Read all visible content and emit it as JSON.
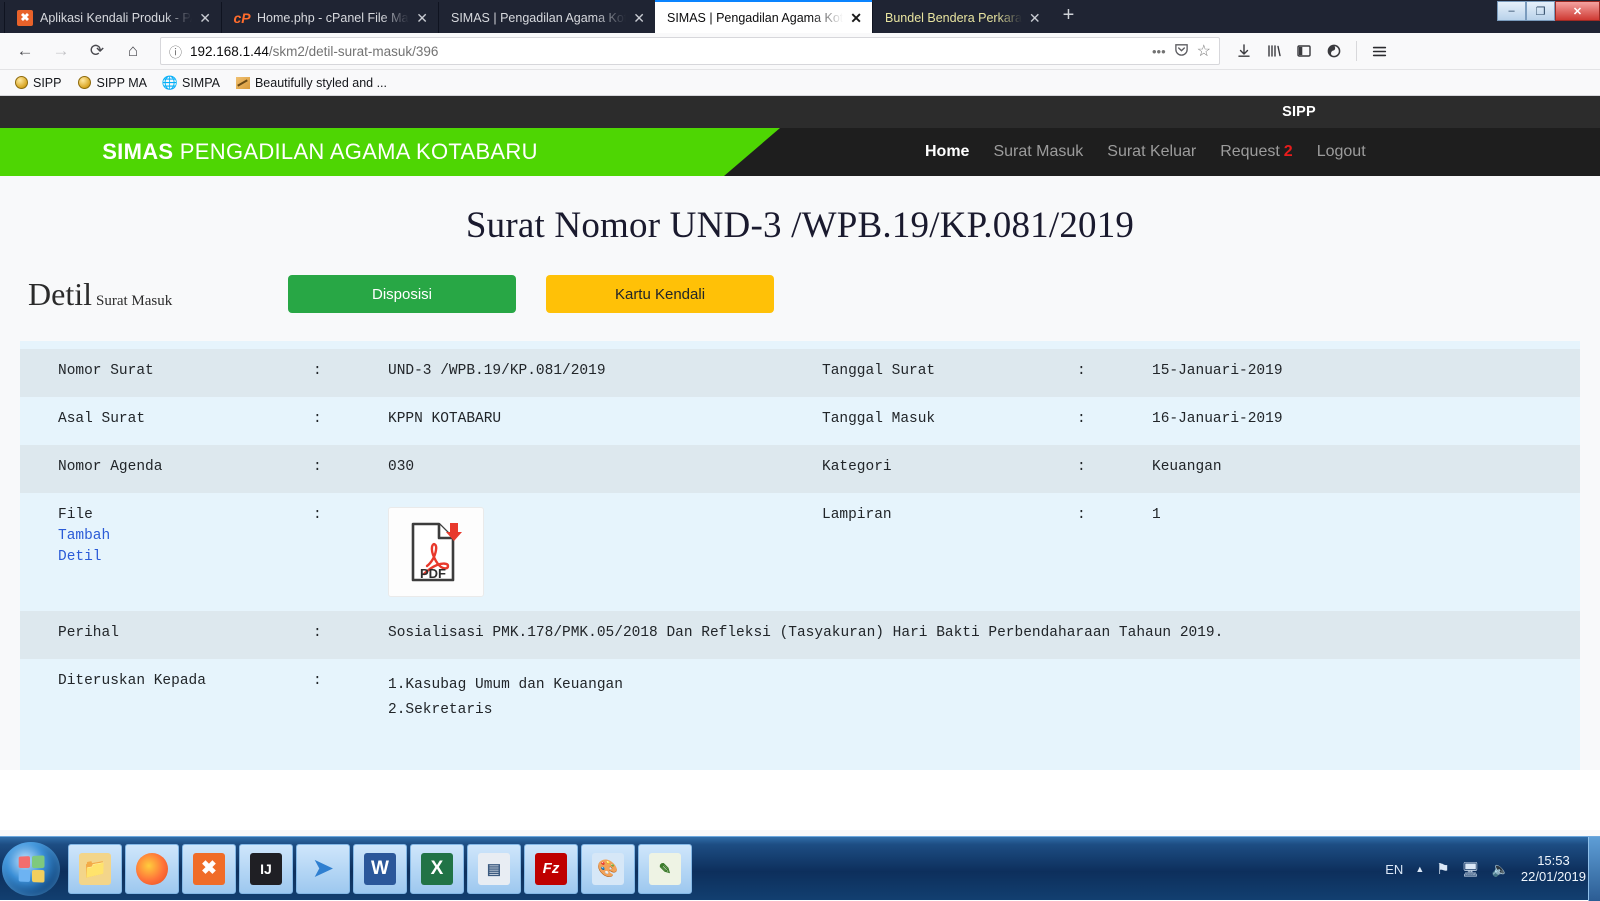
{
  "browser": {
    "tabs": [
      {
        "title": "Aplikasi Kendali Produk - PA.Kt",
        "icon": "xampp-favicon",
        "active": false,
        "highlight": false
      },
      {
        "title": "Home.php - cPanel File Manag",
        "icon": "cpanel-favicon",
        "active": false,
        "highlight": false
      },
      {
        "title": "SIMAS | Pengadilan Agama Kotaba",
        "icon": "none",
        "active": false,
        "highlight": false
      },
      {
        "title": "SIMAS | Pengadilan Agama Kotaba",
        "icon": "none",
        "active": true,
        "highlight": false
      },
      {
        "title": "Bundel Bendera Perkara",
        "icon": "none",
        "active": false,
        "highlight": true
      }
    ],
    "newtab_label": "+",
    "close_glyph": "✕",
    "window_controls": {
      "minimize": "–",
      "maximize": "❐",
      "close": "✕"
    },
    "nav": {
      "back": "←",
      "forward": "→",
      "reload": "⟳",
      "home": "⌂"
    },
    "url": {
      "info_icon": "ⓘ",
      "host": "192.168.1.44",
      "path": "/skm2/detil-surat-masuk/396",
      "page_actions": "•••",
      "pocket_icon": "♡",
      "bookmark_icon": "☆"
    },
    "toolbar_icons": [
      {
        "name": "downloads-icon",
        "glyph": "⤓"
      },
      {
        "name": "library-icon",
        "glyph": "‖‖"
      },
      {
        "name": "sidebar-icon",
        "glyph": "◫"
      },
      {
        "name": "container-tabs-icon",
        "glyph": "◔"
      },
      {
        "name": "menu-icon",
        "glyph": "☰"
      }
    ],
    "bookmarks": [
      {
        "label": "SIPP",
        "icon": "coin"
      },
      {
        "label": "SIPP MA",
        "icon": "coin"
      },
      {
        "label": "SIMPA",
        "icon": "globe"
      },
      {
        "label": "Beautifully styled and ...",
        "icon": "swatch"
      }
    ]
  },
  "site": {
    "topbar_label": "SIPP",
    "brand_strong": "SIMAS",
    "brand_rest": " PENGADILAN AGAMA KOTABARU",
    "nav": [
      {
        "label": "Home",
        "active": true,
        "badge": ""
      },
      {
        "label": "Surat Masuk",
        "active": false,
        "badge": ""
      },
      {
        "label": "Surat Keluar",
        "active": false,
        "badge": ""
      },
      {
        "label": "Request",
        "active": false,
        "badge": "2"
      },
      {
        "label": "Logout",
        "active": false,
        "badge": ""
      }
    ],
    "accent_green": "#4ed603",
    "accent_yellow": "#ffc107"
  },
  "main": {
    "page_title": "Surat Nomor UND-3 /WPB.19/KP.081/2019",
    "heading_big": "Detil",
    "heading_small": "Surat Masuk",
    "buttons": {
      "disposisi": "Disposisi",
      "kartu_kendali": "Kartu Kendali"
    },
    "fields": {
      "nomor_surat_label": "Nomor Surat",
      "nomor_surat_value": "UND-3 /WPB.19/KP.081/2019",
      "tanggal_surat_label": "Tanggal Surat",
      "tanggal_surat_value": "15-Januari-2019",
      "asal_surat_label": "Asal Surat",
      "asal_surat_value": "KPPN KOTABARU",
      "tanggal_masuk_label": "Tanggal Masuk",
      "tanggal_masuk_value": "16-Januari-2019",
      "nomor_agenda_label": "Nomor Agenda",
      "nomor_agenda_value": "030",
      "kategori_label": "Kategori",
      "kategori_value": "Keuangan",
      "file_label": "File",
      "file_link_tambah": "Tambah",
      "file_link_detil": "Detil",
      "file_icon_text": "PDF",
      "lampiran_label": "Lampiran",
      "lampiran_value": "1",
      "perihal_label": "Perihal",
      "perihal_value": "Sosialisasi PMK.178/PMK.05/2018 Dan Refleksi (Tasyakuran) Hari Bakti Perbendaharaan Tahaun 2019.",
      "diteruskan_label": "Diteruskan Kepada",
      "diteruskan_value": "1.Kasubag Umum dan Keuangan\n2.Sekretaris",
      "colon": ":"
    }
  },
  "taskbar": {
    "start_label": "Start",
    "items": [
      {
        "name": "windows-explorer",
        "glyph": "🗂",
        "bg": "#f3d58a",
        "fg": "#7a5b12"
      },
      {
        "name": "firefox",
        "glyph": "●",
        "bg": "#ff7139",
        "fg": "#ffffff"
      },
      {
        "name": "xampp",
        "glyph": "⨉",
        "bg": "#f06c28",
        "fg": "#ffffff"
      },
      {
        "name": "intellij-idea",
        "glyph": "IJ",
        "bg": "#1f1f24",
        "fg": "#ffffff"
      },
      {
        "name": "sqlyog",
        "glyph": "◢",
        "bg": "#2f7fd0",
        "fg": "#ffffff"
      },
      {
        "name": "microsoft-word",
        "glyph": "W",
        "bg": "#2b579a",
        "fg": "#ffffff"
      },
      {
        "name": "microsoft-excel",
        "glyph": "X",
        "bg": "#217346",
        "fg": "#ffffff"
      },
      {
        "name": "system-utility",
        "glyph": "☰",
        "bg": "#e8edf3",
        "fg": "#3b5a80"
      },
      {
        "name": "filezilla",
        "glyph": "Fz",
        "bg": "#bf0000",
        "fg": "#ffffff"
      },
      {
        "name": "paint",
        "glyph": "◕",
        "bg": "#d6e7f7",
        "fg": "#9c4a9c"
      },
      {
        "name": "notepad-app",
        "glyph": "✎",
        "bg": "#eef3e4",
        "fg": "#3b7a2b"
      }
    ],
    "tray": {
      "language": "EN",
      "chevron": "▲",
      "flag_icon": "⚑",
      "network_icon": "🖵",
      "volume_icon": "🔈",
      "time": "15:53",
      "date": "22/01/2019"
    }
  }
}
